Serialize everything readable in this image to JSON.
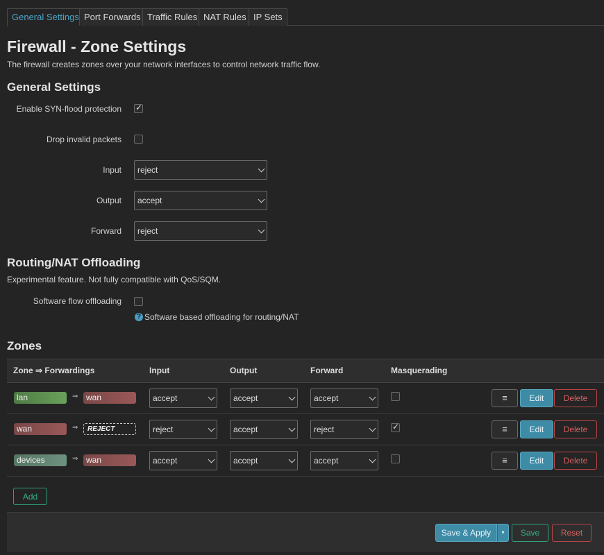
{
  "tabs": [
    "General Settings",
    "Port Forwards",
    "Traffic Rules",
    "NAT Rules",
    "IP Sets"
  ],
  "page_title": "Firewall - Zone Settings",
  "page_description": "The firewall creates zones over your network interfaces to control network traffic flow.",
  "general_settings": {
    "heading": "General Settings",
    "syn_flood": {
      "label": "Enable SYN-flood protection",
      "checked": true
    },
    "drop_invalid": {
      "label": "Drop invalid packets",
      "checked": false
    },
    "input": {
      "label": "Input",
      "value": "reject"
    },
    "output": {
      "label": "Output",
      "value": "accept"
    },
    "forward": {
      "label": "Forward",
      "value": "reject"
    }
  },
  "offloading": {
    "heading": "Routing/NAT Offloading",
    "description": "Experimental feature. Not fully compatible with QoS/SQM.",
    "software_flow": {
      "label": "Software flow offloading",
      "checked": false
    },
    "help": "Software based offloading for routing/NAT",
    "help_icon": "question-circle-icon"
  },
  "zones": {
    "heading": "Zones",
    "columns": [
      "Zone ⇒ Forwardings",
      "Input",
      "Output",
      "Forward",
      "Masquerading"
    ],
    "rows": [
      {
        "zone": "lan",
        "arrow": "⇒",
        "target": "wan",
        "input": "accept",
        "output": "accept",
        "forward": "accept",
        "masq": false
      },
      {
        "zone": "wan",
        "arrow": "⇒",
        "target": "REJECT",
        "input": "reject",
        "output": "accept",
        "forward": "reject",
        "masq": true
      },
      {
        "zone": "devices",
        "arrow": "⇒",
        "target": "wan",
        "input": "accept",
        "output": "accept",
        "forward": "accept",
        "masq": false
      }
    ],
    "menu_icon": "≡",
    "edit_label": "Edit",
    "delete_label": "Delete",
    "add_label": "Add"
  },
  "footer": {
    "save_apply": "Save & Apply",
    "dropdown_caret": "▾",
    "save": "Save",
    "reset": "Reset"
  },
  "colors": {
    "accent": "#3e8ba6",
    "positive": "#34b084",
    "negative": "#d86060",
    "zone_lan": "#6aa25a",
    "zone_wan": "#9a5858",
    "zone_devices": "#6e9280"
  }
}
